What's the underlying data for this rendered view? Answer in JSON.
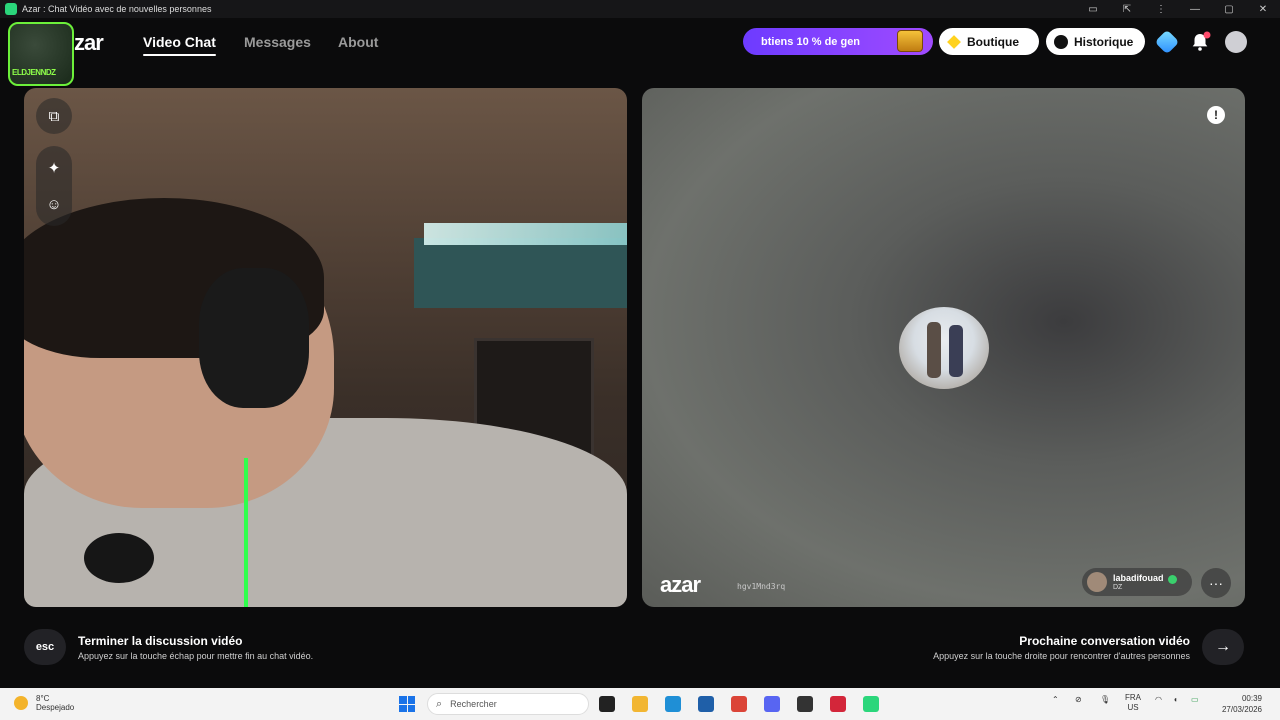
{
  "window": {
    "title": "Azar : Chat Vidéo avec de nouvelles personnes",
    "controls": [
      "▭",
      "⇱",
      "⋮",
      "—",
      "▢",
      "✕"
    ]
  },
  "brand": {
    "logo_badge_text": "ELDJENNDZ",
    "logo_text": "zar"
  },
  "nav": {
    "links": [
      {
        "label": "Video Chat",
        "active": true
      },
      {
        "label": "Messages",
        "active": false
      },
      {
        "label": "About",
        "active": false
      }
    ],
    "promo_text": "btiens 10 % de gen",
    "shop_label": "Boutique",
    "history_label": "Historique",
    "notification_count": "1",
    "icons": [
      "gem-icon",
      "bell-icon",
      "profile-icon"
    ]
  },
  "left_video": {
    "tools": [
      "⧉",
      "✦",
      "☺"
    ]
  },
  "right_video": {
    "report_icon": "!",
    "watermark": "azar",
    "hash": "hgv1Mnd3rq",
    "user": {
      "name": "labadifouad",
      "country": "DZ"
    },
    "chat_icon": "···"
  },
  "footer": {
    "esc_label": "esc",
    "end_title": "Terminer la discussion vidéo",
    "end_sub": "Appuyez sur la touche échap pour mettre fin au chat vidéo.",
    "next_title": "Prochaine conversation vidéo",
    "next_sub": "Appuyez sur la touche droite pour rencontrer d'autres personnes",
    "next_icon": "→"
  },
  "taskbar": {
    "temp": "8°C",
    "weather": "Despejado",
    "search_placeholder": "Rechercher",
    "lang_top": "FRA",
    "lang_bottom": "US",
    "time": "00:39",
    "date": "27/03/2026",
    "apps": [
      {
        "name": "terminal-icon",
        "color": "#222222"
      },
      {
        "name": "folder-icon",
        "color": "#f2b632"
      },
      {
        "name": "edge-icon",
        "color": "#1f8fd6"
      },
      {
        "name": "store-icon",
        "color": "#1f5fa8"
      },
      {
        "name": "chrome-icon",
        "color": "#db4437"
      },
      {
        "name": "discord-icon",
        "color": "#5865f2"
      },
      {
        "name": "obs-icon",
        "color": "#333333"
      },
      {
        "name": "app-red-icon",
        "color": "#d3263a"
      },
      {
        "name": "azar-icon",
        "color": "#2bd67b"
      }
    ]
  }
}
